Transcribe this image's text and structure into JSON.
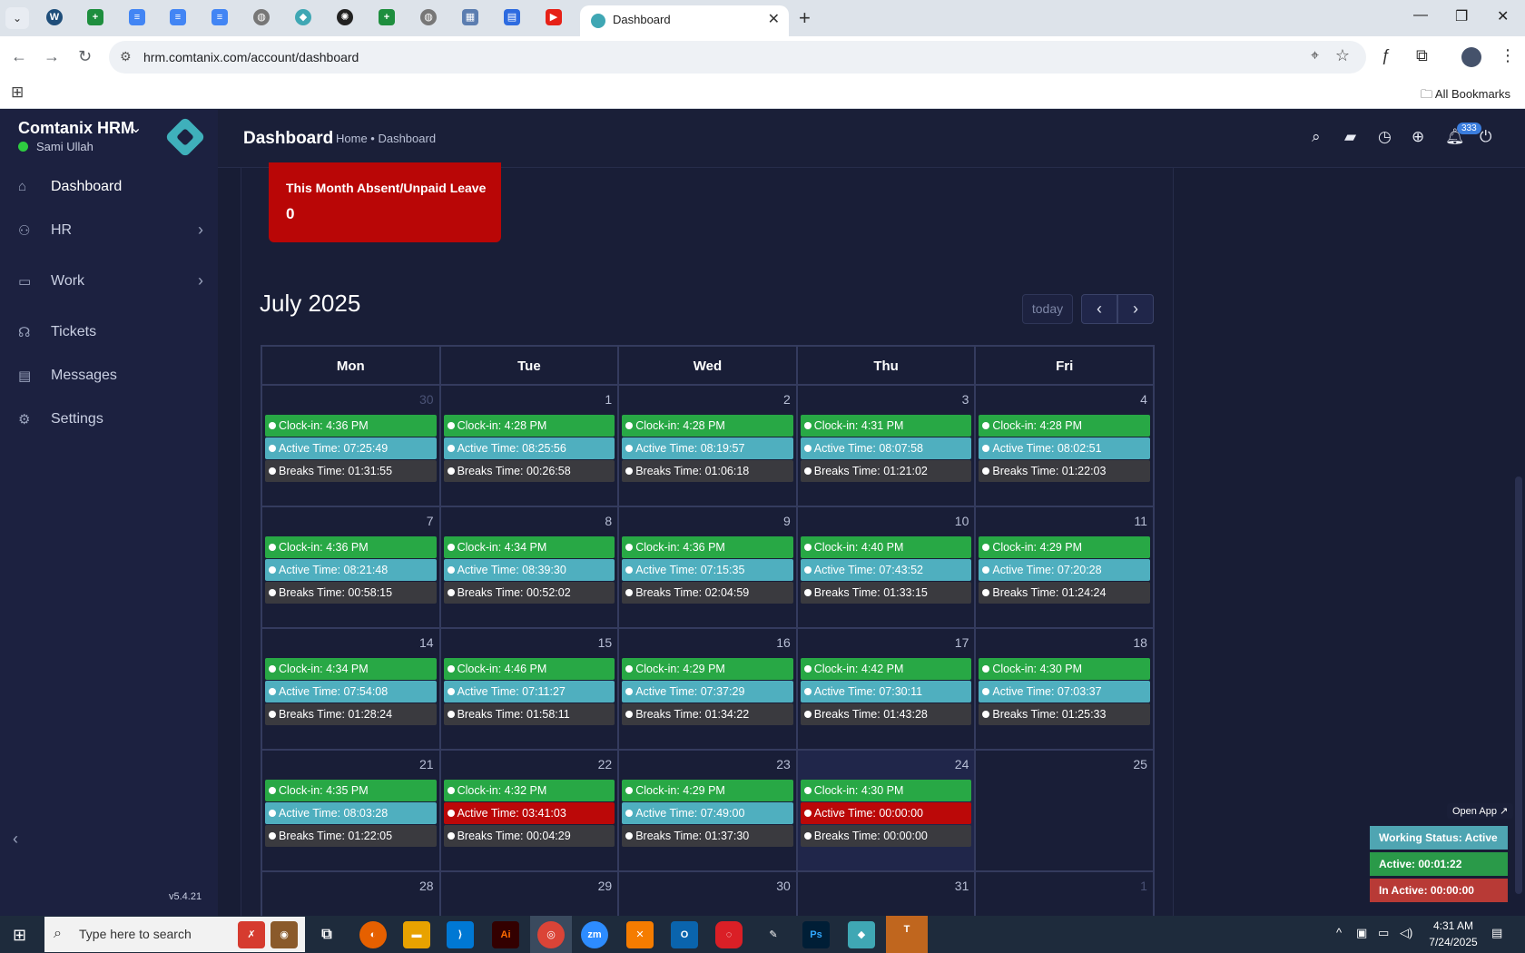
{
  "browser": {
    "active_tab_title": "Dashboard",
    "url": "hrm.comtanix.com/account/dashboard",
    "all_bookmarks": "All Bookmarks"
  },
  "app": {
    "brand": "Comtanix HRM",
    "user": "Sami Ullah",
    "version": "v5.4.21",
    "nav": [
      {
        "label": "Dashboard",
        "icon": "home-icon"
      },
      {
        "label": "HR",
        "icon": "users-icon"
      },
      {
        "label": "Work",
        "icon": "briefcase-icon"
      },
      {
        "label": "Tickets",
        "icon": "headset-icon"
      },
      {
        "label": "Messages",
        "icon": "message-icon"
      },
      {
        "label": "Settings",
        "icon": "gear-icon"
      }
    ],
    "page_title": "Dashboard",
    "breadcrumb": "Home • Dashboard",
    "notification_count": "333"
  },
  "absent_card": {
    "title": "This Month Absent/Unpaid Leave",
    "value": "0"
  },
  "calendar": {
    "title": "July 2025",
    "today_label": "today",
    "weekdays": [
      "Mon",
      "Tue",
      "Wed",
      "Thu",
      "Fri"
    ],
    "weeks": [
      [
        {
          "day": "30",
          "muted": true,
          "clock": "Clock-in: 4:36 PM",
          "active": "Active Time: 07:25:49",
          "breaks": "Breaks Time: 01:31:55"
        },
        {
          "day": "1",
          "clock": "Clock-in: 4:28 PM",
          "active": "Active Time: 08:25:56",
          "breaks": "Breaks Time: 00:26:58"
        },
        {
          "day": "2",
          "clock": "Clock-in: 4:28 PM",
          "active": "Active Time: 08:19:57",
          "breaks": "Breaks Time: 01:06:18"
        },
        {
          "day": "3",
          "clock": "Clock-in: 4:31 PM",
          "active": "Active Time: 08:07:58",
          "breaks": "Breaks Time: 01:21:02"
        },
        {
          "day": "4",
          "clock": "Clock-in: 4:28 PM",
          "active": "Active Time: 08:02:51",
          "breaks": "Breaks Time: 01:22:03"
        }
      ],
      [
        {
          "day": "7",
          "clock": "Clock-in: 4:36 PM",
          "active": "Active Time: 08:21:48",
          "breaks": "Breaks Time: 00:58:15"
        },
        {
          "day": "8",
          "clock": "Clock-in: 4:34 PM",
          "active": "Active Time: 08:39:30",
          "breaks": "Breaks Time: 00:52:02"
        },
        {
          "day": "9",
          "clock": "Clock-in: 4:36 PM",
          "active": "Active Time: 07:15:35",
          "breaks": "Breaks Time: 02:04:59"
        },
        {
          "day": "10",
          "clock": "Clock-in: 4:40 PM",
          "active": "Active Time: 07:43:52",
          "breaks": "Breaks Time: 01:33:15"
        },
        {
          "day": "11",
          "clock": "Clock-in: 4:29 PM",
          "active": "Active Time: 07:20:28",
          "breaks": "Breaks Time: 01:24:24"
        }
      ],
      [
        {
          "day": "14",
          "clock": "Clock-in: 4:34 PM",
          "active": "Active Time: 07:54:08",
          "breaks": "Breaks Time: 01:28:24"
        },
        {
          "day": "15",
          "clock": "Clock-in: 4:46 PM",
          "active": "Active Time: 07:11:27",
          "breaks": "Breaks Time: 01:58:11"
        },
        {
          "day": "16",
          "clock": "Clock-in: 4:29 PM",
          "active": "Active Time: 07:37:29",
          "breaks": "Breaks Time: 01:34:22"
        },
        {
          "day": "17",
          "clock": "Clock-in: 4:42 PM",
          "active": "Active Time: 07:30:11",
          "breaks": "Breaks Time: 01:43:28"
        },
        {
          "day": "18",
          "clock": "Clock-in: 4:30 PM",
          "active": "Active Time: 07:03:37",
          "breaks": "Breaks Time: 01:25:33"
        }
      ],
      [
        {
          "day": "21",
          "clock": "Clock-in: 4:35 PM",
          "active": "Active Time: 08:03:28",
          "breaks": "Breaks Time: 01:22:05"
        },
        {
          "day": "22",
          "clock": "Clock-in: 4:32 PM",
          "active": "Active Time: 03:41:03",
          "active_alert": true,
          "breaks": "Breaks Time: 00:04:29"
        },
        {
          "day": "23",
          "clock": "Clock-in: 4:29 PM",
          "active": "Active Time: 07:49:00",
          "breaks": "Breaks Time: 01:37:30"
        },
        {
          "day": "24",
          "today": true,
          "clock": "Clock-in: 4:30 PM",
          "active": "Active Time: 00:00:00",
          "active_alert": true,
          "breaks": "Breaks Time: 00:00:00"
        },
        {
          "day": "25"
        }
      ],
      [
        {
          "day": "28"
        },
        {
          "day": "29"
        },
        {
          "day": "30"
        },
        {
          "day": "31"
        },
        {
          "day": "1",
          "muted": true
        }
      ]
    ]
  },
  "status_widget": {
    "open_app": "Open App ↗",
    "working_status": "Working Status: Active",
    "active": "Active: 00:01:22",
    "inactive": "In Active: 00:00:00"
  },
  "taskbar": {
    "search_placeholder": "Type here to search",
    "time": "4:31 AM",
    "date": "7/24/2025"
  },
  "colors": {
    "clock_in": "#28a845",
    "active_time": "#4fafbf",
    "breaks_time": "#3a3a3f",
    "alert": "#bb0808",
    "absent_card": "#b90606"
  }
}
